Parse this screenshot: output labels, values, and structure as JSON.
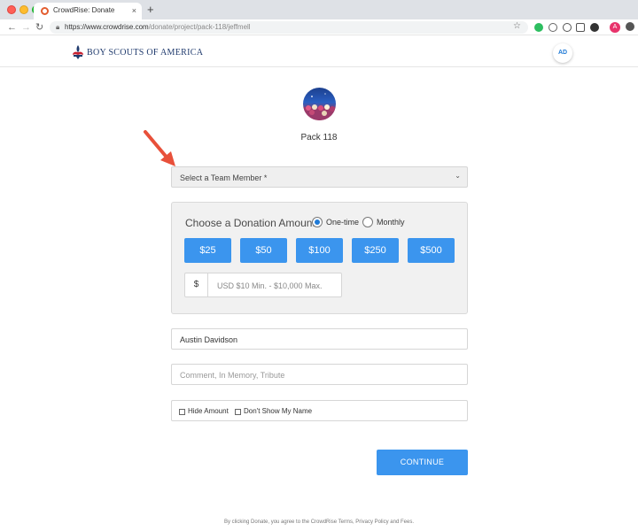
{
  "browser": {
    "tab_title": "CrowdRise: Donate",
    "tab_close": "×",
    "new_tab": "+",
    "url_host": "https://www.crowdrise.com",
    "url_path": "/donate/project/pack-118/jeffmell",
    "profile_initial": "A",
    "icons": [
      "back-arrow-icon",
      "forward-arrow-icon",
      "reload-icon",
      "lock-icon",
      "star-icon"
    ]
  },
  "header": {
    "org_name": "BOY SCOUTS OF AMERICA",
    "user_initials": "AD"
  },
  "team": {
    "name": "Pack 118"
  },
  "team_member_select": {
    "placeholder": "Select a Team Member *"
  },
  "donation": {
    "title": "Choose a Donation Amount",
    "frequency_options": [
      "One-time",
      "Monthly"
    ],
    "selected_frequency": "One-time",
    "amounts": [
      "$25",
      "$50",
      "$100",
      "$250",
      "$500"
    ],
    "currency_symbol": "$",
    "custom_placeholder": "USD $10 Min. - $10,000 Max."
  },
  "donor": {
    "name_value": "Austin Davidson",
    "comment_placeholder": "Comment, In Memory, Tribute",
    "hide_amount_label": "Hide Amount",
    "hide_name_label": "Don't Show My Name"
  },
  "continue_label": "CONTINUE",
  "footer_note": "By clicking Donate, you agree to the CrowdRise Terms, Privacy Policy and Fees.",
  "colors": {
    "primary_button": "#3b95ee",
    "annotation_arrow": "#e8503a",
    "org_navy": "#1f3a6d"
  }
}
